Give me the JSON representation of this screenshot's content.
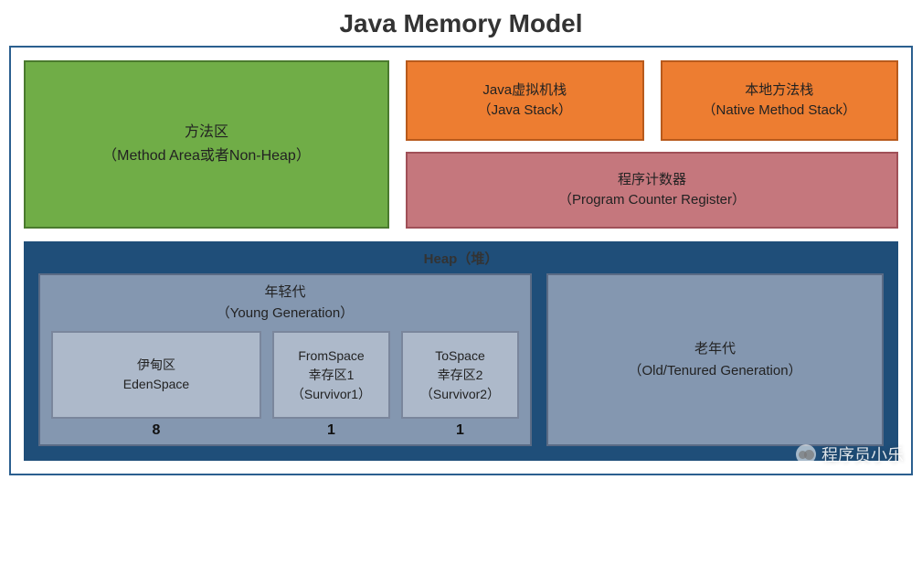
{
  "title": "Java Memory Model",
  "method_area": {
    "line1": "方法区",
    "line2": "（Method Area或者Non-Heap）"
  },
  "java_stack": {
    "line1": "Java虚拟机栈",
    "line2": "（Java Stack）"
  },
  "native_stack": {
    "line1": "本地方法栈",
    "line2": "（Native Method Stack）"
  },
  "pc_register": {
    "line1": "程序计数器",
    "line2": "（Program Counter Register）"
  },
  "heap": {
    "label": "Heap（堆）",
    "young": {
      "line1": "年轻代",
      "line2": "（Young Generation）",
      "eden": {
        "line1": "伊甸区",
        "line2": "EdenSpace",
        "ratio": "8"
      },
      "from": {
        "line1": "FromSpace",
        "line2": "幸存区1",
        "line3": "（Survivor1）",
        "ratio": "1"
      },
      "to": {
        "line1": "ToSpace",
        "line2": "幸存区2",
        "line3": "（Survivor2）",
        "ratio": "1"
      }
    },
    "old": {
      "line1": "老年代",
      "line2": "（Old/Tenured Generation）"
    }
  },
  "watermark": "程序员小乐"
}
